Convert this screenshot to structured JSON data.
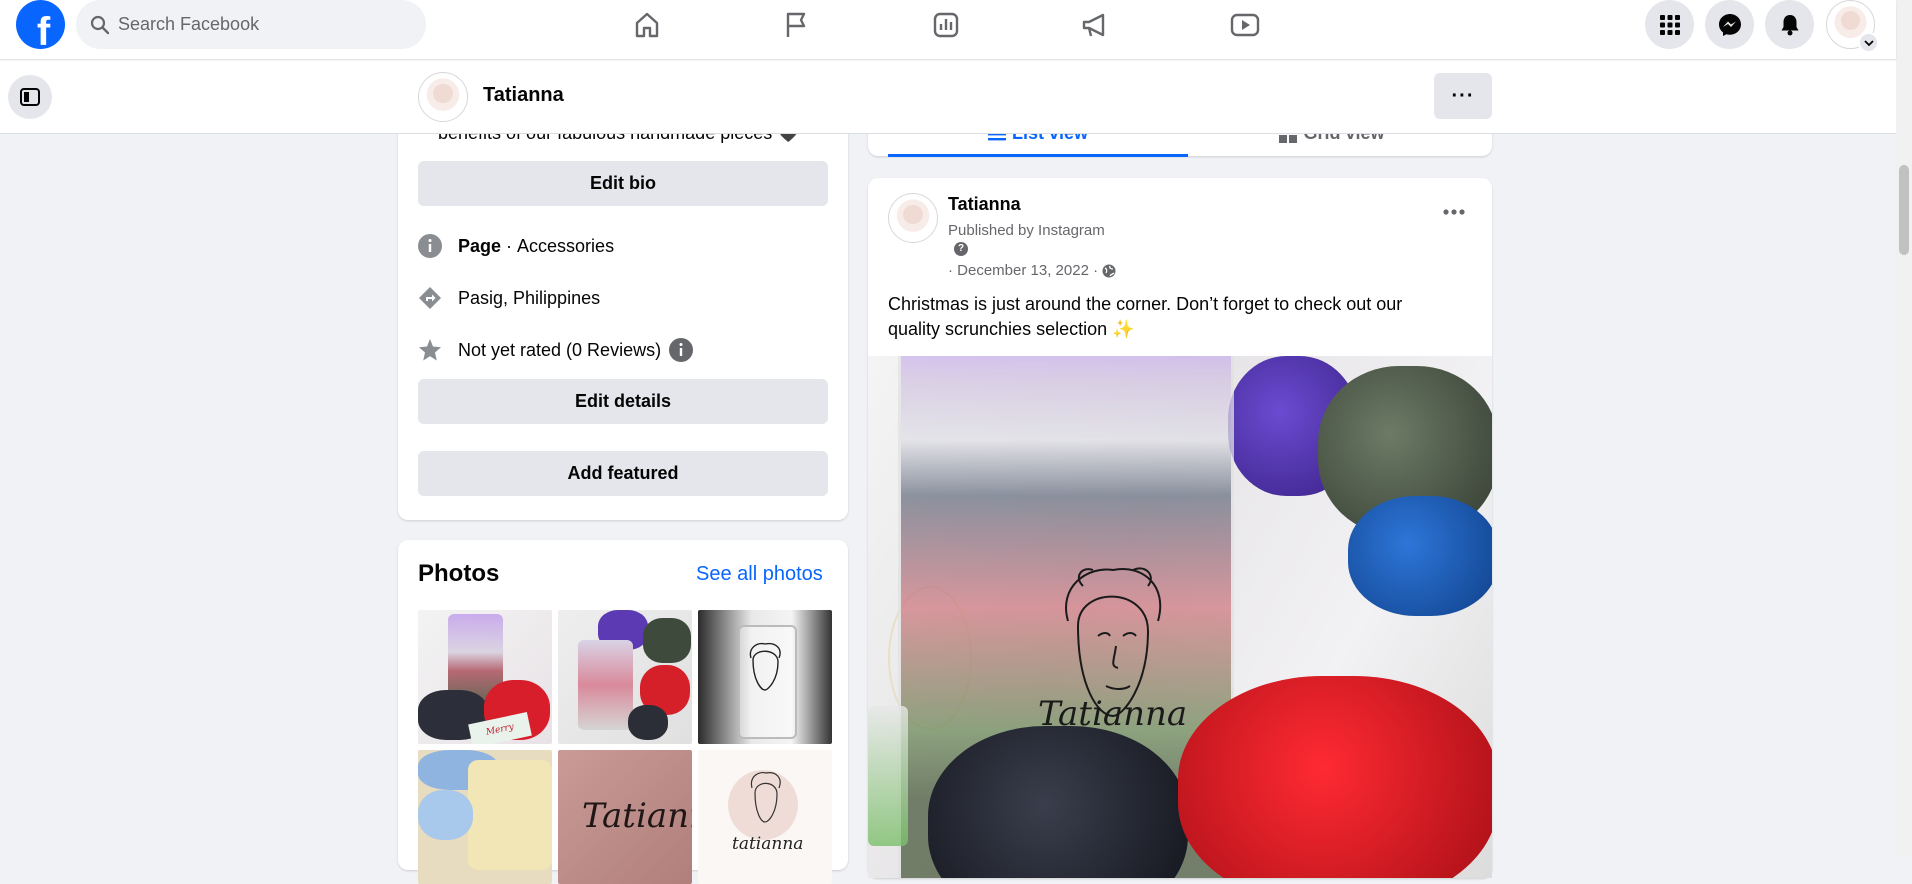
{
  "topbar": {
    "search": {
      "placeholder": "Search Facebook"
    },
    "nav_icons": [
      "home-icon",
      "flag-icon",
      "insights-icon",
      "megaphone-icon",
      "video-icon"
    ],
    "right_icons": [
      "menu-grid-icon",
      "messenger-icon",
      "bell-icon"
    ]
  },
  "pagebar": {
    "name": "Tatianna",
    "more_label": "···"
  },
  "intro": {
    "bio_tail": "benefits of our fabulous handmade pieces",
    "edit_bio": "Edit bio",
    "category_label": "Page",
    "category_sep": " · ",
    "category_value": "Accessories",
    "location": "Pasig, Philippines",
    "rating": "Not yet rated (0 Reviews)",
    "edit_details": "Edit details",
    "add_featured": "Add featured"
  },
  "photos": {
    "title": "Photos",
    "see_all": "See all photos",
    "thumbs": [
      {
        "name": "photo-tumbler-scrunchies",
        "caption": "Merry Christmas!"
      },
      {
        "name": "photo-tumbler-pink-scrunchies"
      },
      {
        "name": "photo-tumbler-bw"
      },
      {
        "name": "photo-scrunchies-box"
      },
      {
        "name": "photo-tatianna-logo-pink",
        "caption": "Tatianna"
      },
      {
        "name": "photo-tatianna-logo-line",
        "caption": "tatianna"
      }
    ]
  },
  "view_toggle": {
    "list_view": "List view",
    "grid_view": "Grid view",
    "active": "list"
  },
  "post": {
    "author": "Tatianna",
    "published_by": "Published by Instagram",
    "date": "· December 13, 2022 ·",
    "text_line1": "Christmas is just around the corner. Don’t forget to check out our",
    "text_line2": "quality scrunchies selection ✨",
    "image_caption": "Tatianna"
  },
  "colors": {
    "brand": "#0866ff",
    "button_gray": "#e4e6eb",
    "page_bg": "#f0f2f5"
  }
}
